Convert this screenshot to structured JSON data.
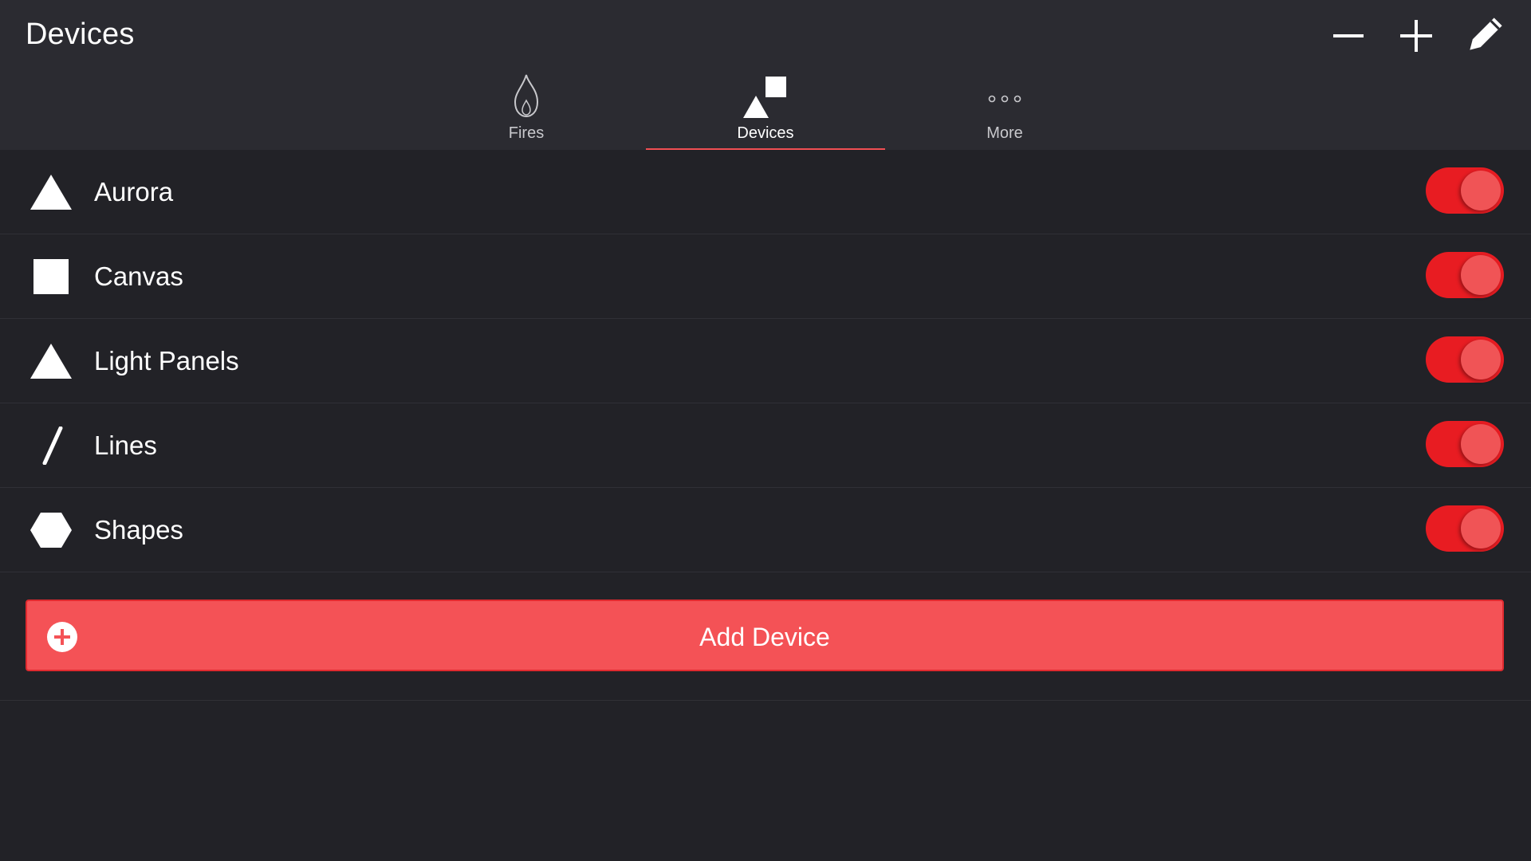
{
  "header": {
    "title": "Devices",
    "actions": [
      {
        "icon": "minus-icon"
      },
      {
        "icon": "plus-icon"
      },
      {
        "icon": "pencil-icon"
      }
    ]
  },
  "tabs": [
    {
      "label": "Fires",
      "icon": "flame-icon",
      "active": false
    },
    {
      "label": "Devices",
      "icon": "devices-icon",
      "active": true
    },
    {
      "label": "More",
      "icon": "ellipsis-icon",
      "active": false
    }
  ],
  "devices": [
    {
      "label": "Aurora",
      "icon": "triangle-icon",
      "enabled": true
    },
    {
      "label": "Canvas",
      "icon": "square-icon",
      "enabled": true
    },
    {
      "label": "Light Panels",
      "icon": "triangle-icon",
      "enabled": true
    },
    {
      "label": "Lines",
      "icon": "line-icon",
      "enabled": true
    },
    {
      "label": "Shapes",
      "icon": "hexagon-icon",
      "enabled": true
    }
  ],
  "add_button": {
    "label": "Add Device",
    "icon": "plus-circle-icon"
  },
  "colors": {
    "accent": "#f04f53",
    "toggle_on": "#e81c22",
    "background": "#222227",
    "header_background": "#2b2b31"
  }
}
